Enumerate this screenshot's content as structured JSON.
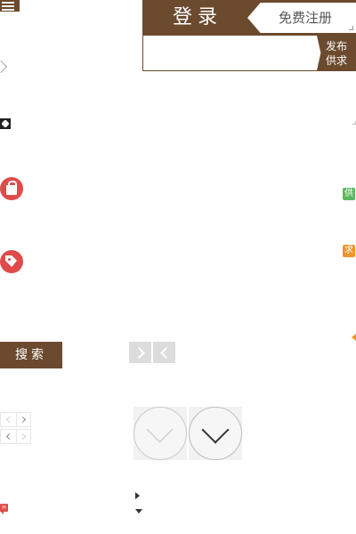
{
  "header": {
    "login_label": "登录",
    "register_label": "免费注册",
    "publish_label_line1": "发布",
    "publish_label_line2": "供求"
  },
  "side_badges": {
    "supply": "供",
    "demand": "求"
  },
  "search": {
    "button_label": "搜索"
  },
  "hot_badge": {
    "label": "H"
  },
  "colors": {
    "brand_brown": "#6b4a2e",
    "icon_red": "#e04a4a",
    "supply_green": "#5cb85c",
    "demand_orange": "#f0932b"
  },
  "icons": [
    "list-icon",
    "chevron-right-outline-icon",
    "expand-icon",
    "shopping-bag-icon",
    "tag-icon",
    "chevron-right-icon",
    "chevron-left-icon",
    "chevron-down-circle-icon",
    "caret-right-icon",
    "caret-down-icon"
  ]
}
